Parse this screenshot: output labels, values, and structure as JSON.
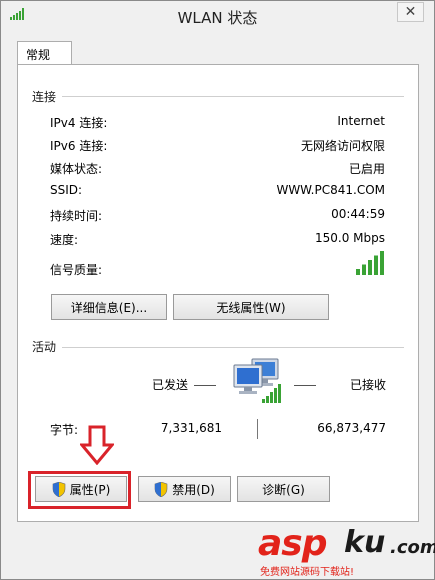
{
  "window": {
    "title": "WLAN 状态",
    "close_glyph": "✕"
  },
  "tabs": [
    {
      "label": "常规"
    }
  ],
  "connection": {
    "section_title": "连接",
    "rows": [
      {
        "label": "IPv4 连接:",
        "value": "Internet"
      },
      {
        "label": "IPv6 连接:",
        "value": "无网络访问权限"
      },
      {
        "label": "媒体状态:",
        "value": "已启用"
      },
      {
        "label": "SSID:",
        "value": "WWW.PC841.COM"
      },
      {
        "label": "持续时间:",
        "value": "00:44:59"
      },
      {
        "label": "速度:",
        "value": "150.0 Mbps"
      }
    ],
    "signal_label": "信号质量:",
    "signal_bars_total": 5,
    "signal_bars_filled": 5,
    "details_button": "详细信息(E)...",
    "wireless_props_button": "无线属性(W)"
  },
  "activity": {
    "section_title": "活动",
    "sent_label": "已发送",
    "received_label": "已接收",
    "bytes_label": "字节:",
    "bytes_sent": "7,331,681",
    "bytes_received": "66,873,477"
  },
  "buttons": {
    "properties": "属性(P)",
    "disable": "禁用(D)",
    "diagnose": "诊断(G)"
  },
  "watermark": {
    "brand_asp": "asp",
    "brand_ku": "ku",
    "brand_com": ".com",
    "tagline": "免费网站源码下载站!"
  },
  "colors": {
    "signal_green": "#3aa335",
    "highlight_red": "#d9232a",
    "brand_red": "#e2231a"
  }
}
